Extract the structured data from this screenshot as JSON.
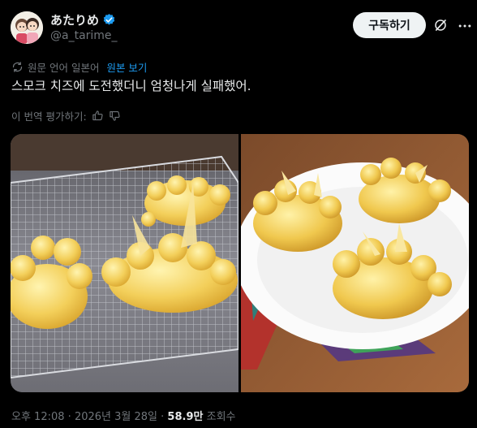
{
  "author": {
    "display_name": "あたりめ",
    "handle": "@a_tarime_"
  },
  "actions": {
    "subscribe_label": "구독하기"
  },
  "translation": {
    "translated_from": "원문 언어 일본어",
    "show_original": "원본 보기",
    "rate_prompt": "이 번역 평가하기:"
  },
  "tweet": {
    "text": "스모크 치즈에 도전했더니 엄청나게 실패했어."
  },
  "meta": {
    "time": "오후 12:08",
    "separator": "·",
    "date": "2026년 3월 28일",
    "views_count": "58.9만",
    "views_label": "조회수"
  },
  "colors": {
    "background": "#000000",
    "accent": "#1d9bf0",
    "secondary_text": "#71767b",
    "cheese": "#f3cf5a"
  }
}
